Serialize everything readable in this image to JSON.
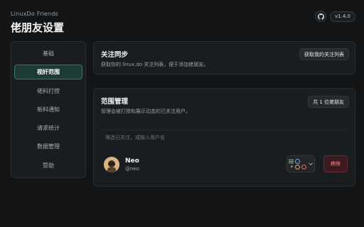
{
  "app": {
    "name": "LinuxDo Friends",
    "page_title": "佬朋友设置",
    "version": "v1.4.0"
  },
  "sidebar": {
    "items": [
      {
        "label": "基础",
        "active": false
      },
      {
        "label": "视奸范围",
        "active": true
      },
      {
        "label": "佬料打捞",
        "active": false
      },
      {
        "label": "新料通知",
        "active": false
      },
      {
        "label": "请求统计",
        "active": false
      },
      {
        "label": "数据管理",
        "active": false
      },
      {
        "label": "赞助",
        "active": false
      }
    ]
  },
  "sync_card": {
    "title": "关注同步",
    "description": "获取你的 linux.do 关注列表，便于添加佬朋友。",
    "button_label": "获取我的关注列表"
  },
  "scope_card": {
    "title": "范围管理",
    "description": "管理会被打捞和展示动态的已关注用户。",
    "count_label": "共 1 位佬朋友",
    "search_placeholder": "筛选已关注，或输入用户名",
    "users": [
      {
        "name": "Neo",
        "handle": "@neo",
        "remove_label": "移除"
      }
    ]
  },
  "colors": {
    "accent": "#2f7a68",
    "danger": "#ff8f9a",
    "background": "#121415",
    "card": "#1a1d1f"
  },
  "icons": {
    "user_feature_icons": [
      "list-icon",
      "chat-icon",
      "rocket-icon",
      "smile-icon",
      "heart-icon"
    ]
  }
}
